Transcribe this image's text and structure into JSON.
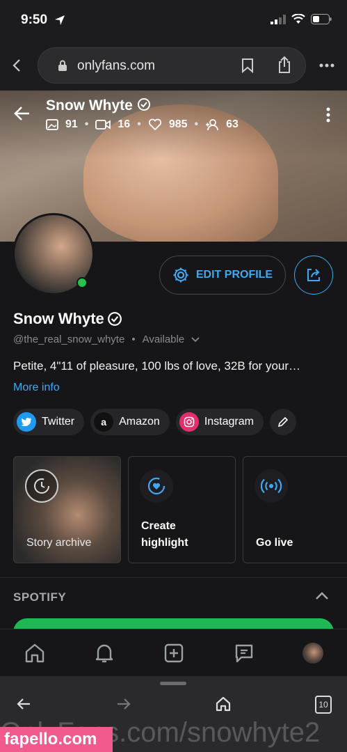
{
  "status_bar": {
    "time": "9:50"
  },
  "browser": {
    "url": "onlyfans.com"
  },
  "cover": {
    "name": "Snow Whyte",
    "stats": {
      "photos": "91",
      "videos": "16",
      "likes": "985",
      "fans": "63"
    }
  },
  "profile": {
    "name": "Snow Whyte",
    "handle": "@the_real_snow_whyte",
    "availability": "Available",
    "bio": "Petite, 4\"11 of pleasure, 100 lbs of love, 32B for your…",
    "more_info": "More info",
    "edit_profile": "EDIT PROFILE",
    "accent_color": "#3ea9f5",
    "online_color": "#25c04e"
  },
  "socials": [
    {
      "label": "Twitter",
      "icon": "twitter-icon",
      "color": "#1d9bf0"
    },
    {
      "label": "Amazon",
      "icon": "amazon-icon",
      "color": "#111111"
    },
    {
      "label": "Instagram",
      "icon": "instagram-icon",
      "color": "#e1306c"
    }
  ],
  "cards": {
    "archive": "Story archive",
    "highlight_line1": "Create",
    "highlight_line2": "highlight",
    "live": "Go live"
  },
  "spotify": {
    "title": "SPOTIFY",
    "color": "#1db954"
  },
  "safari": {
    "tabs_count": "10"
  },
  "watermark": {
    "url": "OnlyFans.com/snowhyte2",
    "badge": "fapello.com"
  }
}
